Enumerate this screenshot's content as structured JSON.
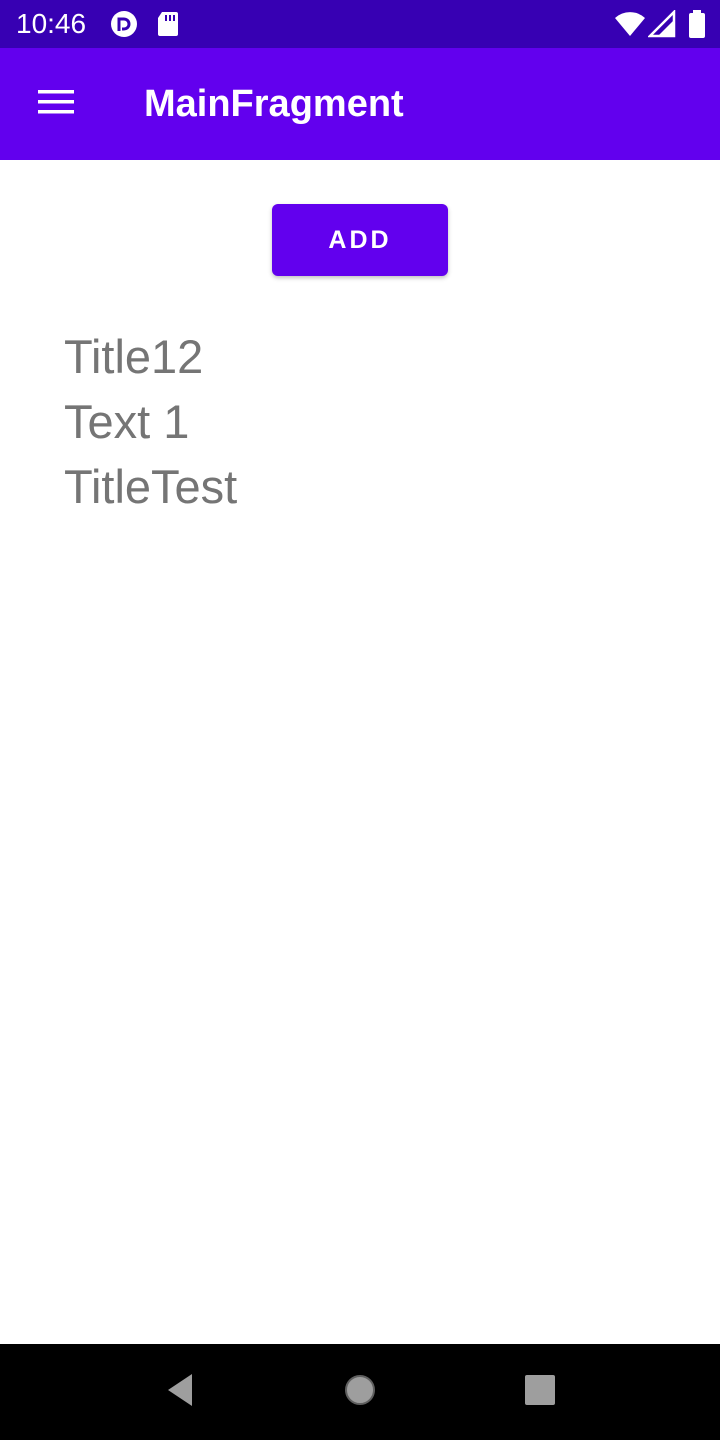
{
  "status_bar": {
    "time": "10:46",
    "left_icons": [
      "pocket-casts-icon",
      "sd-card-icon"
    ],
    "right_icons": [
      "wifi-icon",
      "signal-icon",
      "battery-icon"
    ]
  },
  "app_bar": {
    "title": "MainFragment",
    "nav_icon": "hamburger-menu-icon"
  },
  "content": {
    "add_button_label": "ADD",
    "items": [
      "Title12",
      "Text 1",
      "TitleTest"
    ]
  },
  "nav_bar": {
    "buttons": [
      "back",
      "home",
      "recents"
    ]
  },
  "colors": {
    "status_bar": "#3700b3",
    "primary": "#6200ee",
    "text_secondary": "#757575",
    "nav_bar": "#000000"
  }
}
